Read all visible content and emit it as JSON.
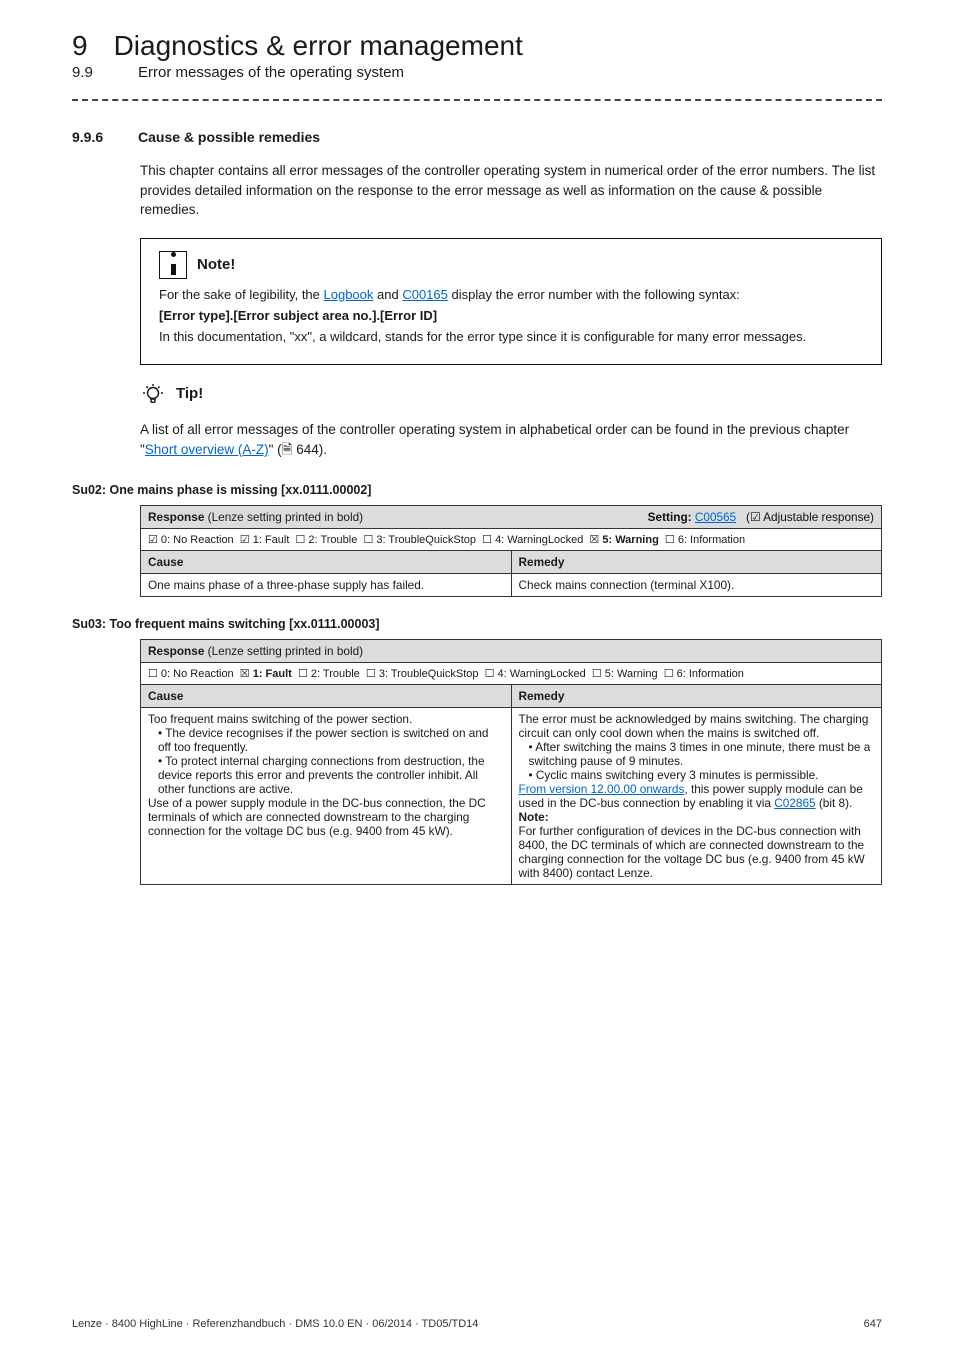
{
  "header": {
    "chapterNum": "9",
    "chapterTitle": "Diagnostics & error management",
    "sectionNum": "9.9",
    "sectionTitle": "Error messages of the operating system"
  },
  "subsection": {
    "num": "9.9.6",
    "title": "Cause & possible remedies"
  },
  "intro": "This chapter contains all error messages of the controller operating system in numerical order of the error numbers. The list provides detailed information on the response to the error message as well as information on the cause & possible remedies.",
  "note": {
    "label": "Note!",
    "p1a": "For the sake of legibility, the ",
    "logbook": "Logbook",
    "p1b": " and ",
    "c00165": "C00165",
    "p1c": " display the error number with the following syntax:",
    "syntax": "[Error type].[Error subject area no.].[Error ID]",
    "p2": "In this documentation, \"xx\", a wildcard, stands for the error type since it is configurable for many error messages."
  },
  "tip": {
    "label": "Tip!",
    "p_a": "A list of all error messages of the controller operating system in alphabetical order can be found in the previous chapter \"",
    "p_link": "Short overview (A-Z)",
    "p_b": "\"  (🗎 644)."
  },
  "err1": {
    "heading": "Su02: One mains phase is missing [xx.0111.00002]",
    "responseLabel": "Response",
    "responseNote": " (Lenze setting printed in bold)",
    "settingLabel": "Setting:",
    "settingCode": "C00565",
    "settingAdj": "(☑ Adjustable response)",
    "opts": "☑ 0: No Reaction  ☑ 1: Fault  ☐ 2: Trouble  ☐ 3: TroubleQuickStop  ☐ 4: WarningLocked  ☒ 5: Warning  ☐ 6: Information",
    "causeH": "Cause",
    "remedyH": "Remedy",
    "cause": "One mains phase of a three-phase supply has failed.",
    "remedy": "Check mains connection (terminal X100)."
  },
  "err2": {
    "heading": "Su03: Too frequent mains switching [xx.0111.00003]",
    "responseLabel": "Response",
    "responseNote": " (Lenze setting printed in bold)",
    "opts": "☐ 0: No Reaction  ☒ 1: Fault  ☐ 2: Trouble  ☐ 3: TroubleQuickStop  ☐ 4: WarningLocked  ☐ 5: Warning  ☐ 6: Information",
    "causeH": "Cause",
    "remedyH": "Remedy",
    "cause_l1": "Too frequent mains switching of the power section.",
    "cause_b1": "• The device recognises if the power section is switched on and off too frequently.",
    "cause_b2": "• To protect internal charging connections from destruction, the device reports this error and prevents the controller inhibit. All other functions are active.",
    "cause_l2": "Use of a power supply module in the DC-bus connection, the DC terminals of which are connected downstream to the charging connection for the voltage DC bus (e.g. 9400 from 45 kW).",
    "rem_l1": "The error must be acknowledged by mains switching. The charging circuit can only cool down when the mains is switched off.",
    "rem_b1": "• After switching the mains 3 times in one minute, there must be a switching pause of 9 minutes.",
    "rem_b2": "• Cyclic mains switching every 3 minutes is permissible.",
    "rem_link1": "From version 12.00.00 onwards",
    "rem_l2": ", this power supply module can be used in the DC-bus connection by enabling it via ",
    "rem_link2": "C02865",
    "rem_l2b": " (bit 8).",
    "rem_noteH": "Note:",
    "rem_note": "For further configuration of devices in the DC-bus connection with 8400, the DC terminals of which are connected downstream to the charging connection for the voltage DC bus (e.g. 9400 from 45 kW with 8400) contact Lenze."
  },
  "footer": {
    "left": "Lenze · 8400 HighLine · Referenzhandbuch · DMS 10.0 EN · 06/2014 · TD05/TD14",
    "right": "647"
  }
}
